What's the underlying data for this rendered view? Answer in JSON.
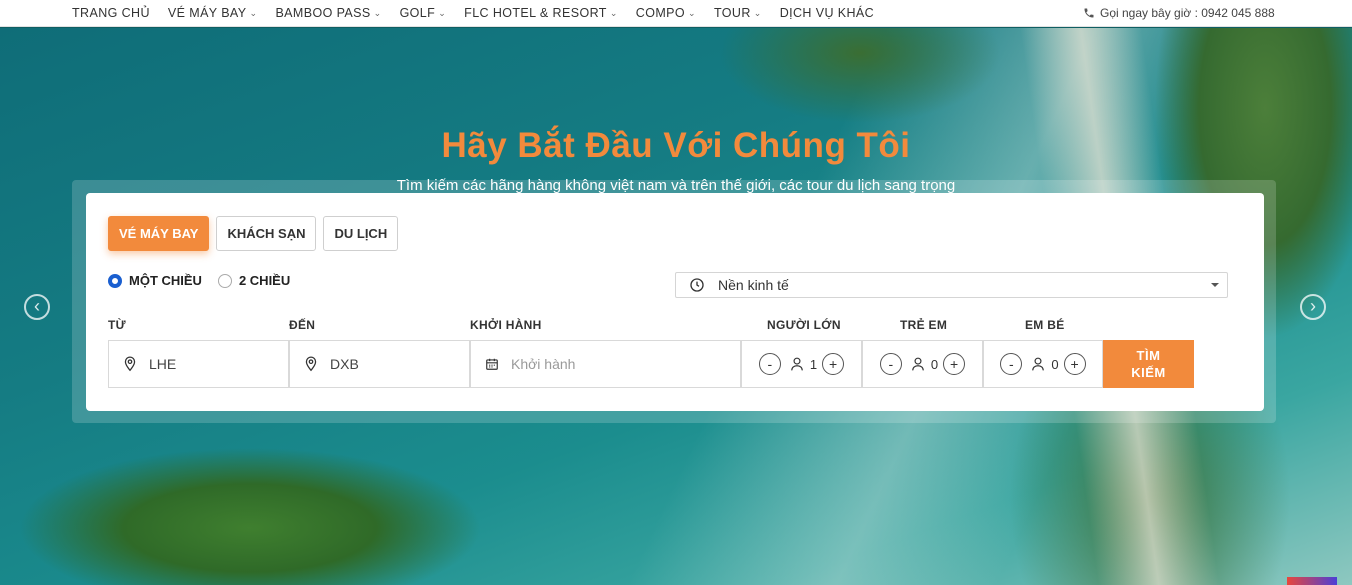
{
  "nav": {
    "items": [
      {
        "label": "TRANG CHỦ",
        "dropdown": false
      },
      {
        "label": "VÉ MÁY BAY",
        "dropdown": true
      },
      {
        "label": "BAMBOO PASS",
        "dropdown": true
      },
      {
        "label": "GOLF",
        "dropdown": true
      },
      {
        "label": "FLC HOTEL & RESORT",
        "dropdown": true
      },
      {
        "label": "COMPO",
        "dropdown": true
      },
      {
        "label": "TOUR",
        "dropdown": true
      },
      {
        "label": "DỊCH VỤ KHÁC",
        "dropdown": false
      }
    ],
    "hotline": "Gọi ngay bây giờ : 0942 045 888"
  },
  "hero": {
    "title": "Hãy Bắt Đầu Với Chúng Tôi",
    "subtitle": "Tìm kiếm các hãng hàng không việt nam và trên thế giới, các tour du lịch sang trọng"
  },
  "search": {
    "tabs": [
      {
        "label": "VÉ MÁY BAY",
        "active": true
      },
      {
        "label": "KHÁCH SẠN",
        "active": false
      },
      {
        "label": "DU LỊCH",
        "active": false
      }
    ],
    "trip_types": [
      {
        "label": "MỘT CHIỀU",
        "selected": true
      },
      {
        "label": "2 CHIỀU",
        "selected": false
      }
    ],
    "cabin_class": "Nền kinh tế",
    "labels": {
      "from": "TỪ",
      "to": "ĐẾN",
      "depart": "KHỞI HÀNH",
      "adults": "NGƯỜI LỚN",
      "children": "TRẺ EM",
      "infants": "EM BÉ"
    },
    "from_value": "LHE",
    "to_value": "DXB",
    "depart_placeholder": "Khởi hành",
    "adults": "1",
    "children": "0",
    "infants": "0",
    "minus": "-",
    "plus": "+",
    "search_button": "TÌM KIẾM"
  },
  "colors": {
    "accent": "#f28a3c",
    "radio": "#1a5fd0"
  }
}
